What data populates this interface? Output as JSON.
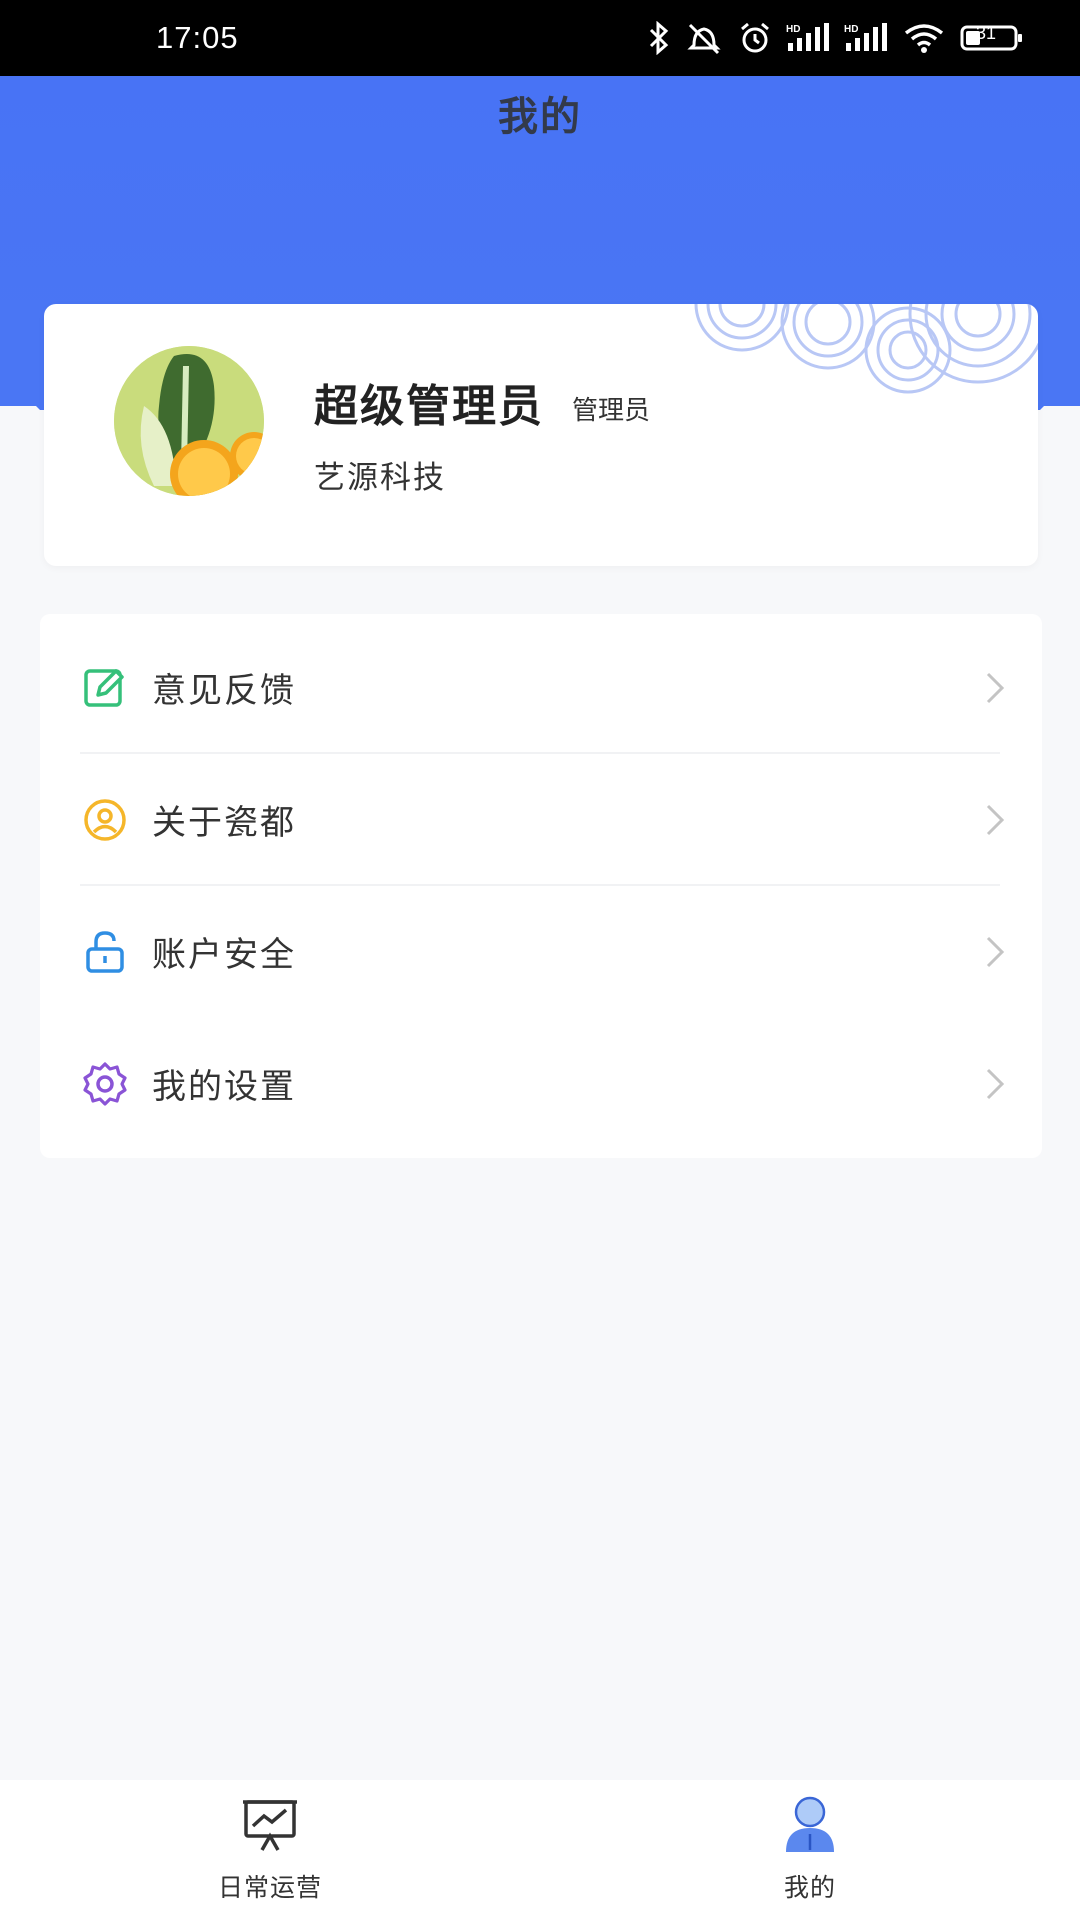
{
  "status_bar": {
    "time": "17:05",
    "battery": "31",
    "icons": [
      "bluetooth-icon",
      "mute-icon",
      "alarm-icon",
      "hd-signal-icon",
      "hd-signal-icon",
      "wifi-icon",
      "battery-icon"
    ],
    "hd_label": "HD"
  },
  "header": {
    "title": "我的",
    "color": "#4a76f4"
  },
  "profile": {
    "name": "超级管理员",
    "role": "管理员",
    "company": "艺源科技"
  },
  "menu": {
    "items": [
      {
        "label": "意见反馈",
        "icon": "edit-icon",
        "color": "#35c07a"
      },
      {
        "label": "关于瓷都",
        "icon": "user-circle-icon",
        "color": "#f5b62a"
      },
      {
        "label": "账户安全",
        "icon": "unlock-icon",
        "color": "#2f8ee3"
      },
      {
        "label": "我的设置",
        "icon": "gear-icon",
        "color": "#8a54d6"
      }
    ]
  },
  "tabs": [
    {
      "label": "日常运营",
      "icon": "presentation-chart-icon",
      "active": false
    },
    {
      "label": "我的",
      "icon": "person-icon",
      "active": true
    }
  ]
}
